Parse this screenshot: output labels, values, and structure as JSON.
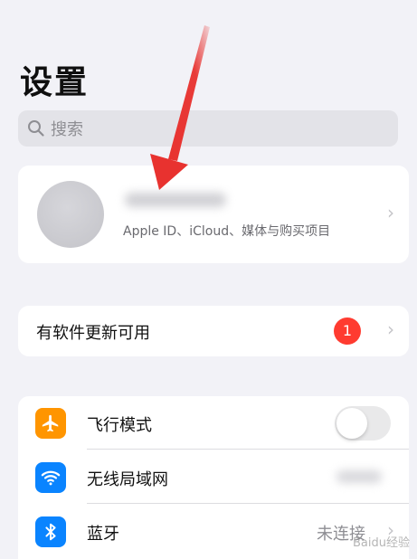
{
  "header": {
    "title": "设置"
  },
  "search": {
    "placeholder": "搜索",
    "icon": "search-icon"
  },
  "profile": {
    "subtitle": "Apple ID、iCloud、媒体与购买项目"
  },
  "update": {
    "label": "有软件更新可用",
    "badge": "1",
    "badge_color": "#ff3b30"
  },
  "settings": {
    "rows": [
      {
        "label": "飞行模式",
        "icon": "airplane-icon",
        "icon_color": "#ff9500",
        "toggle_on": false
      },
      {
        "label": "无线局域网",
        "icon": "wifi-icon",
        "icon_color": "#0a84ff"
      },
      {
        "label": "蓝牙",
        "icon": "bluetooth-icon",
        "icon_color": "#0a84ff",
        "value": "未连接"
      }
    ]
  },
  "annotation": {
    "arrow_color": "#e8322f"
  },
  "watermark": "Baidu经验"
}
